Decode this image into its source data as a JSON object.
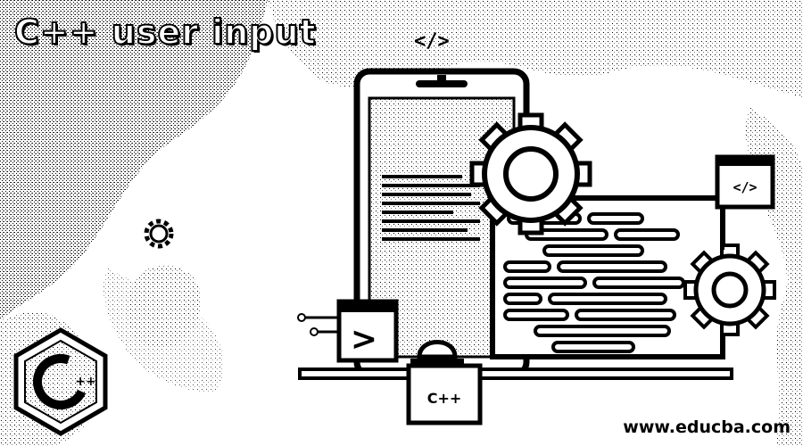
{
  "title": "C++ user input",
  "code_tag": "</>",
  "small_code_tag": "</>",
  "terminal_glyph": ">",
  "base_logo": "C++",
  "logo": {
    "letter": "C",
    "plus": "++"
  },
  "website": "www.educba.com",
  "icons": [
    "gear-icon",
    "code-icon",
    "terminal-icon",
    "cpp-logo-icon"
  ],
  "colors": {
    "ink": "#000000",
    "paper": "#ffffff",
    "grain": "#b8b8b8"
  }
}
